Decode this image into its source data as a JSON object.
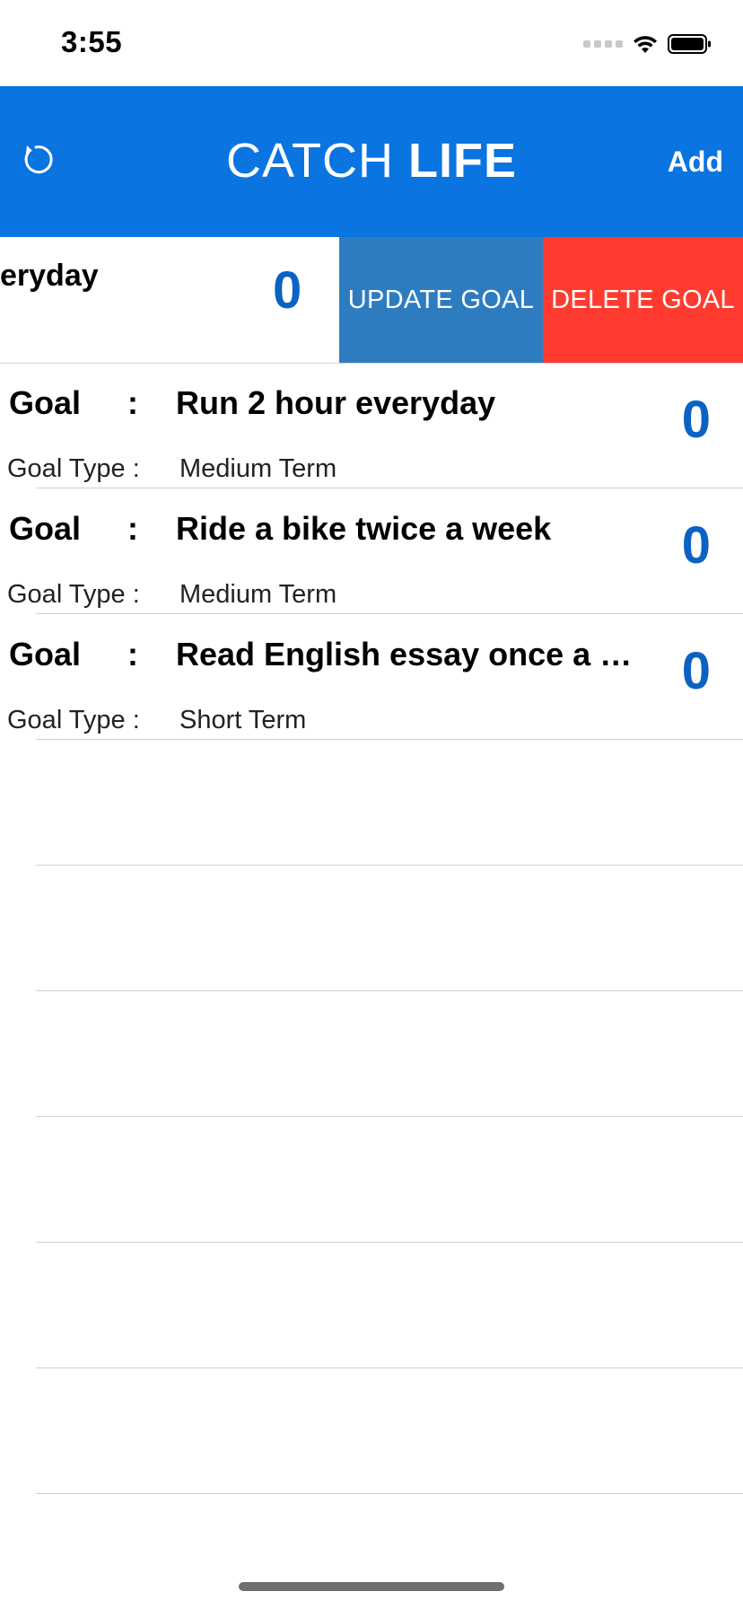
{
  "status_bar": {
    "time": "3:55"
  },
  "nav": {
    "title_light": "CATCH",
    "title_bold": "LIFE",
    "add_label": "Add",
    "refresh_icon": "refresh-icon"
  },
  "swiped_row": {
    "visible_text": "eryday",
    "count": "0",
    "update_label": "UPDATE GOAL",
    "delete_label": "DELETE GOAL"
  },
  "goals": [
    {
      "label": "Goal",
      "colon": ":",
      "name": "Run 2 hour everyday",
      "count": "0",
      "type_label": "Goal Type :",
      "type_value": "Medium Term"
    },
    {
      "label": "Goal",
      "colon": ":",
      "name": "Ride a bike twice a week",
      "count": "0",
      "type_label": "Goal Type :",
      "type_value": "Medium Term"
    },
    {
      "label": "Goal",
      "colon": ":",
      "name": "Read English essay once a w…",
      "count": "0",
      "type_label": "Goal Type :",
      "type_value": "Short Term"
    }
  ],
  "colors": {
    "nav_background": "#0a74e0",
    "update_button": "#2e7cc0",
    "delete_button": "#ff3b30",
    "count_text": "#0b62c4"
  }
}
